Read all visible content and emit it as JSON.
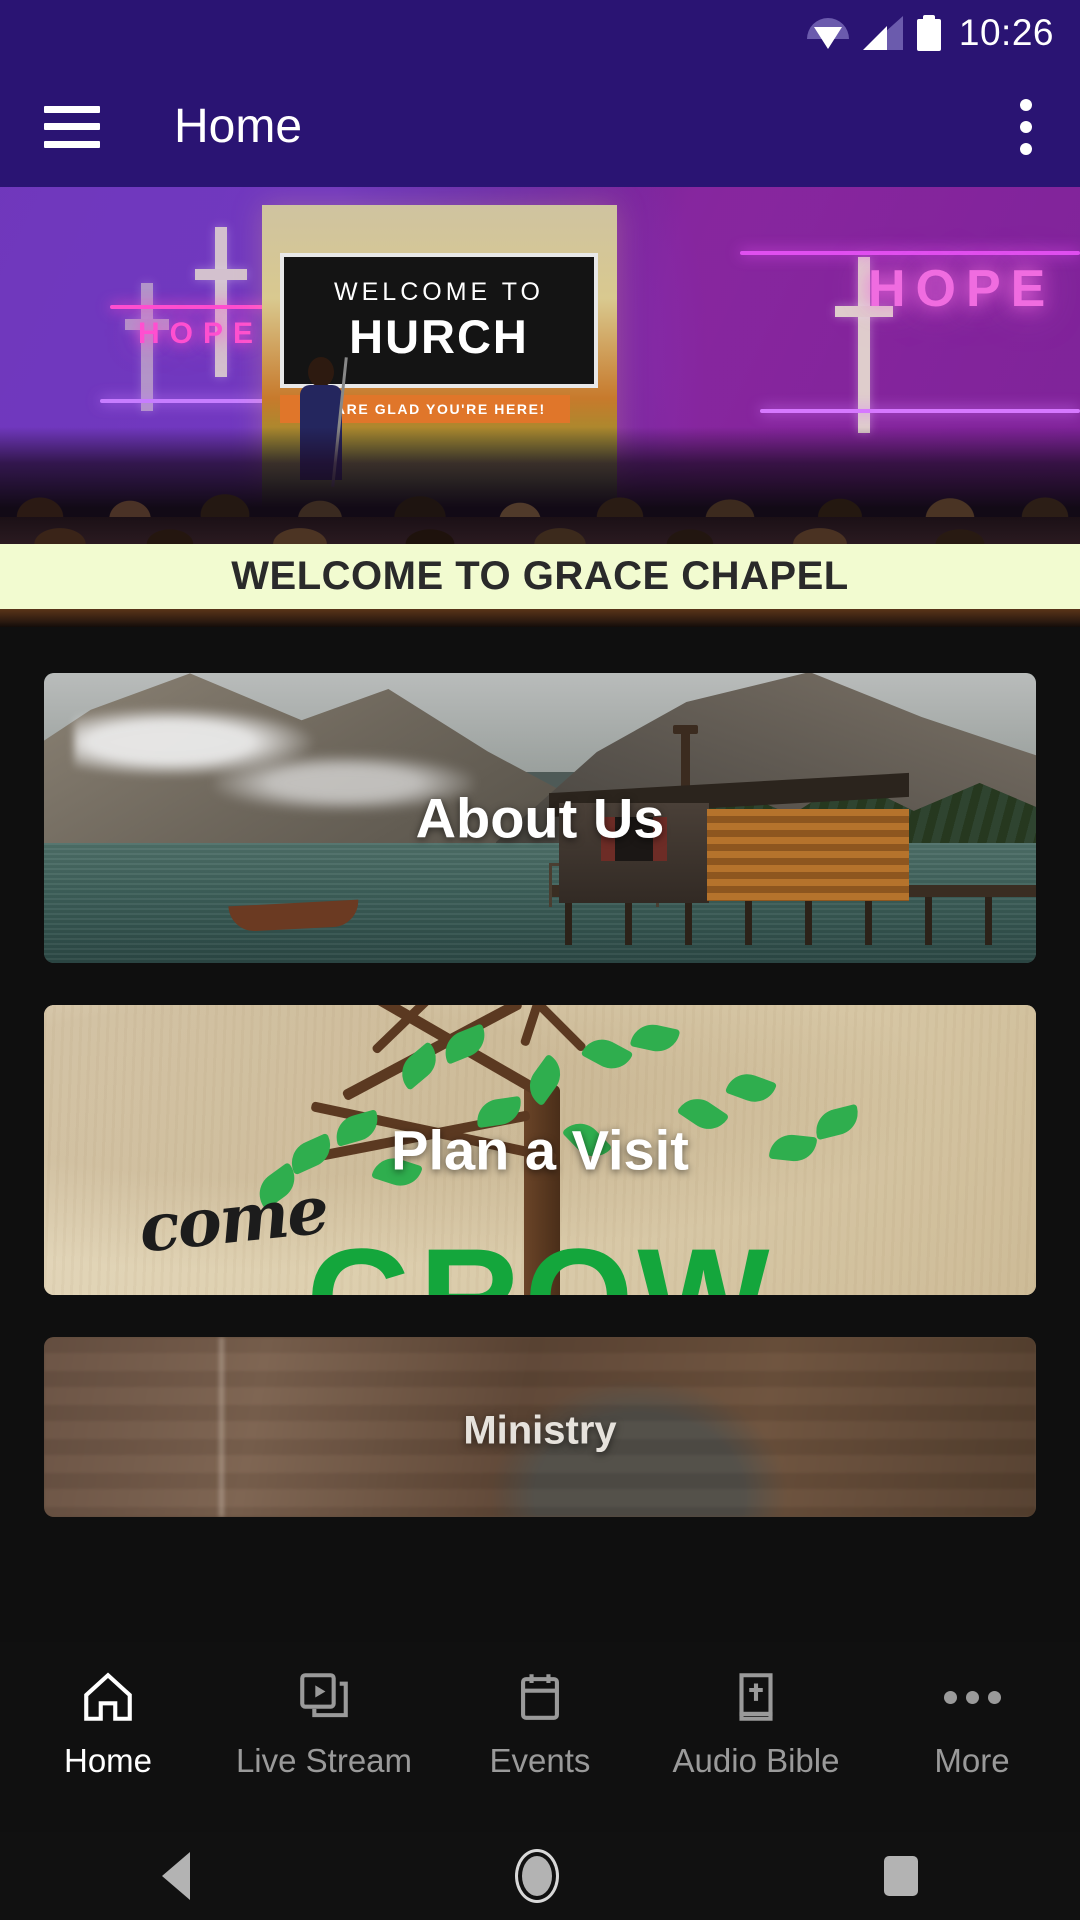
{
  "status_bar": {
    "time": "10:26",
    "icons": [
      "wifi-icon",
      "cellular-signal-icon",
      "battery-icon"
    ]
  },
  "app_bar": {
    "menu_icon": "hamburger-menu-icon",
    "title": "Home",
    "overflow_icon": "kebab-menu-icon",
    "background_color": "#2a1473"
  },
  "hero": {
    "screen_line1": "WELCOME TO",
    "screen_line2": "HURCH",
    "screen_strip": "WE ARE GLAD YOU'RE HERE!",
    "neon_left": "HOPE",
    "neon_right": "HOPE"
  },
  "welcome_banner": {
    "text": "WELCOME TO GRACE CHAPEL",
    "background_color": "#f2fbd0",
    "text_color": "#2a2a2a"
  },
  "cards": [
    {
      "label": "About Us"
    },
    {
      "label": "Plan a Visit"
    },
    {
      "label": "Ministry"
    }
  ],
  "visit_card_art": {
    "script_word": "come",
    "big_word": "GROW",
    "leaf_color": "#2fae4e",
    "grow_color": "#14a63c"
  },
  "bottom_nav": {
    "items": [
      {
        "label": "Home",
        "icon": "home-icon",
        "active": true
      },
      {
        "label": "Live Stream",
        "icon": "live-stream-icon",
        "active": false
      },
      {
        "label": "Events",
        "icon": "calendar-icon",
        "active": false
      },
      {
        "label": "Audio Bible",
        "icon": "bible-icon",
        "active": false
      },
      {
        "label": "More",
        "icon": "more-dots-icon",
        "active": false
      }
    ],
    "active_color": "#ffffff",
    "inactive_color": "#9a9a9a"
  },
  "system_nav": {
    "back": "back-triangle-icon",
    "home": "home-circle-icon",
    "recents": "recents-square-icon"
  }
}
